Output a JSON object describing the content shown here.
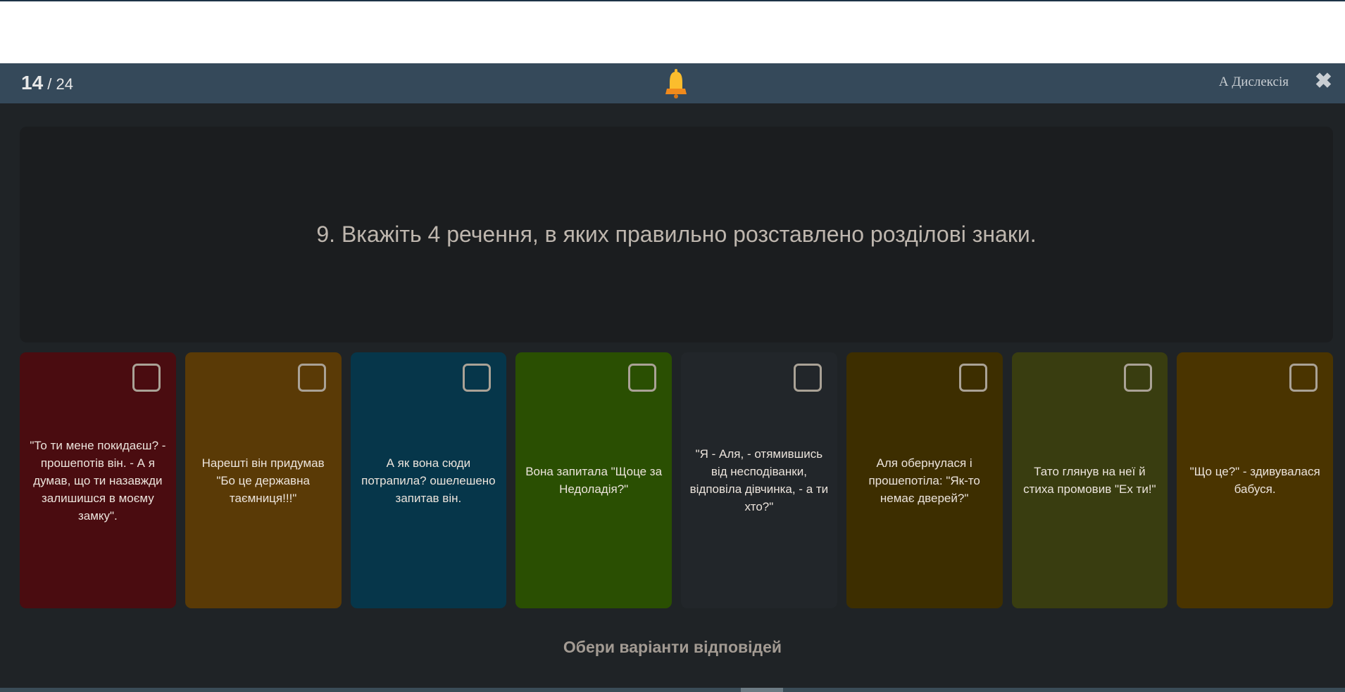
{
  "header": {
    "current": "14",
    "total": "/ 24",
    "dyslexia_label": "А Дислексія",
    "close_icon": "close-icon",
    "bell_icon": "bell-icon"
  },
  "question": {
    "text": "9. Вкажіть 4 речення, в яких правильно розставлено розділові знаки."
  },
  "options": [
    {
      "text": "\"То ти мене покидаєш? - прошепотів він. - А я думав, що ти назавжди залишишся в моєму замку\".",
      "color": "#4a0c10"
    },
    {
      "text": "Нарешті він придумав \"Бо це державна таємниця!!!\"",
      "color": "#5a3a06"
    },
    {
      "text": "А як вона сюди потрапила? ошелешено запитав він.",
      "color": "#06364a"
    },
    {
      "text": "Вона запитала \"Щоце за Недоладія?\"",
      "color": "#2a4f02"
    },
    {
      "text": "\"Я - Аля, - отямившись від несподіванки, відповіла дівчинка, - а ти хто?\"",
      "color": "#22262a"
    },
    {
      "text": "Аля обернулася і прошепотіла: \"Як-то немає дверей?\"",
      "color": "#3d2e00"
    },
    {
      "text": "Тато глянув на неї й стиха промовив \"Ех ти!\"",
      "color": "#393d10"
    },
    {
      "text": "\"Що це?\" - здивувалася бабуся.",
      "color": "#4a3400"
    }
  ],
  "hint": "Обери варіанти відповідей"
}
